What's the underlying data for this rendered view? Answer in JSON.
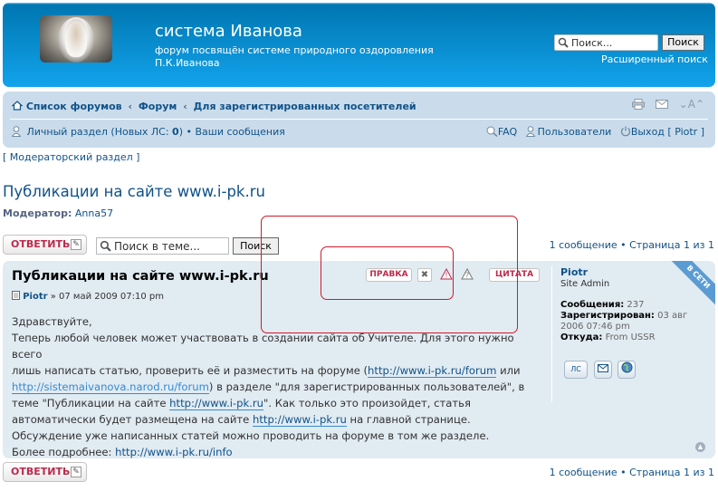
{
  "header": {
    "title": "система Иванова",
    "description": "форум посвящён системе природного оздоровления П.К.Иванова",
    "search_placeholder": "Поиск...",
    "search_button": "Поиск",
    "advanced_search": "Расширенный поиск"
  },
  "nav": {
    "crumbs": [
      "Список форумов",
      "Форум",
      "Для зарегистрированных посетителей"
    ],
    "crumb_sep": "‹",
    "pm_label": "Личный раздел (Новых ЛС: ",
    "pm_count": "0",
    "pm_close": ")",
    "bullet": "•",
    "your_posts": "Ваши сообщения",
    "faq": "FAQ",
    "members": "Пользователи",
    "logout": "Выход [ Piotr ]",
    "font_size": "A"
  },
  "moderator_panel": "[ Модераторский раздел ]",
  "topic": {
    "title_prefix": "Публикации на сайте ",
    "title_link": "www.i-pk.ru",
    "moderator_label": "Модератор:",
    "moderator_name": "Anna57"
  },
  "actions": {
    "reply": "ОТВЕТИТЬ",
    "search_placeholder": "Поиск в теме...",
    "search_button": "Поиск",
    "pagination": "1 сообщение • Страница 1 из 1"
  },
  "post": {
    "title": "Публикации на сайте www.i-pk.ru",
    "author": "Piotr",
    "date": "» 07 май 2009 07:10 pm",
    "edit": "ПРАВКА",
    "quote": "ЦИТАТА",
    "body": {
      "l1": "Здравствуйте,",
      "l2": "Теперь любой человек может участвовать в создании сайта об Учителе. Для этого нужно всего",
      "l3a": "лишь написать статью, проверить её и разместить на форуме (",
      "l3link": "http://www.i-pk.ru/forum",
      "l3b": " или",
      "l4link": "http://sistemaivanova.narod.ru/forum",
      "l4b": ") в разделе \"для зарегистрированных пользователей\", в",
      "l5a": "теме \"Публикации на сайте ",
      "l5link": "http://www.i-pk.ru",
      "l5b": "\". Как только это произойдет, статья",
      "l6a": "автоматически будет размещена на сайте ",
      "l6link": "http://www.i-pk.ru",
      "l6b": " на главной странице.",
      "l7": "Обсуждение уже написанных статей можно проводить на форуме в том же разделе.",
      "l8a": "Более подробнее: ",
      "l8link": "http://www.i-pk.ru/info"
    },
    "profile": {
      "username": "Piotr",
      "rank": "Site Admin",
      "posts_label": "Сообщения:",
      "posts_value": "237",
      "joined_label": "Зарегистрирован:",
      "joined_value_1": "03 авг",
      "joined_value_2": "2006 07:46 pm",
      "from_label": "Откуда:",
      "from_value": "From USSR",
      "pm_button": "ЛС",
      "online": "В СЕТИ"
    }
  },
  "colors": {
    "header": "#12a3eb",
    "navbar": "#cadceb",
    "post_bg": "#e1ebf2",
    "link": "#105289",
    "button_text": "#bc2a4d",
    "highlight": "#d01b2c"
  }
}
